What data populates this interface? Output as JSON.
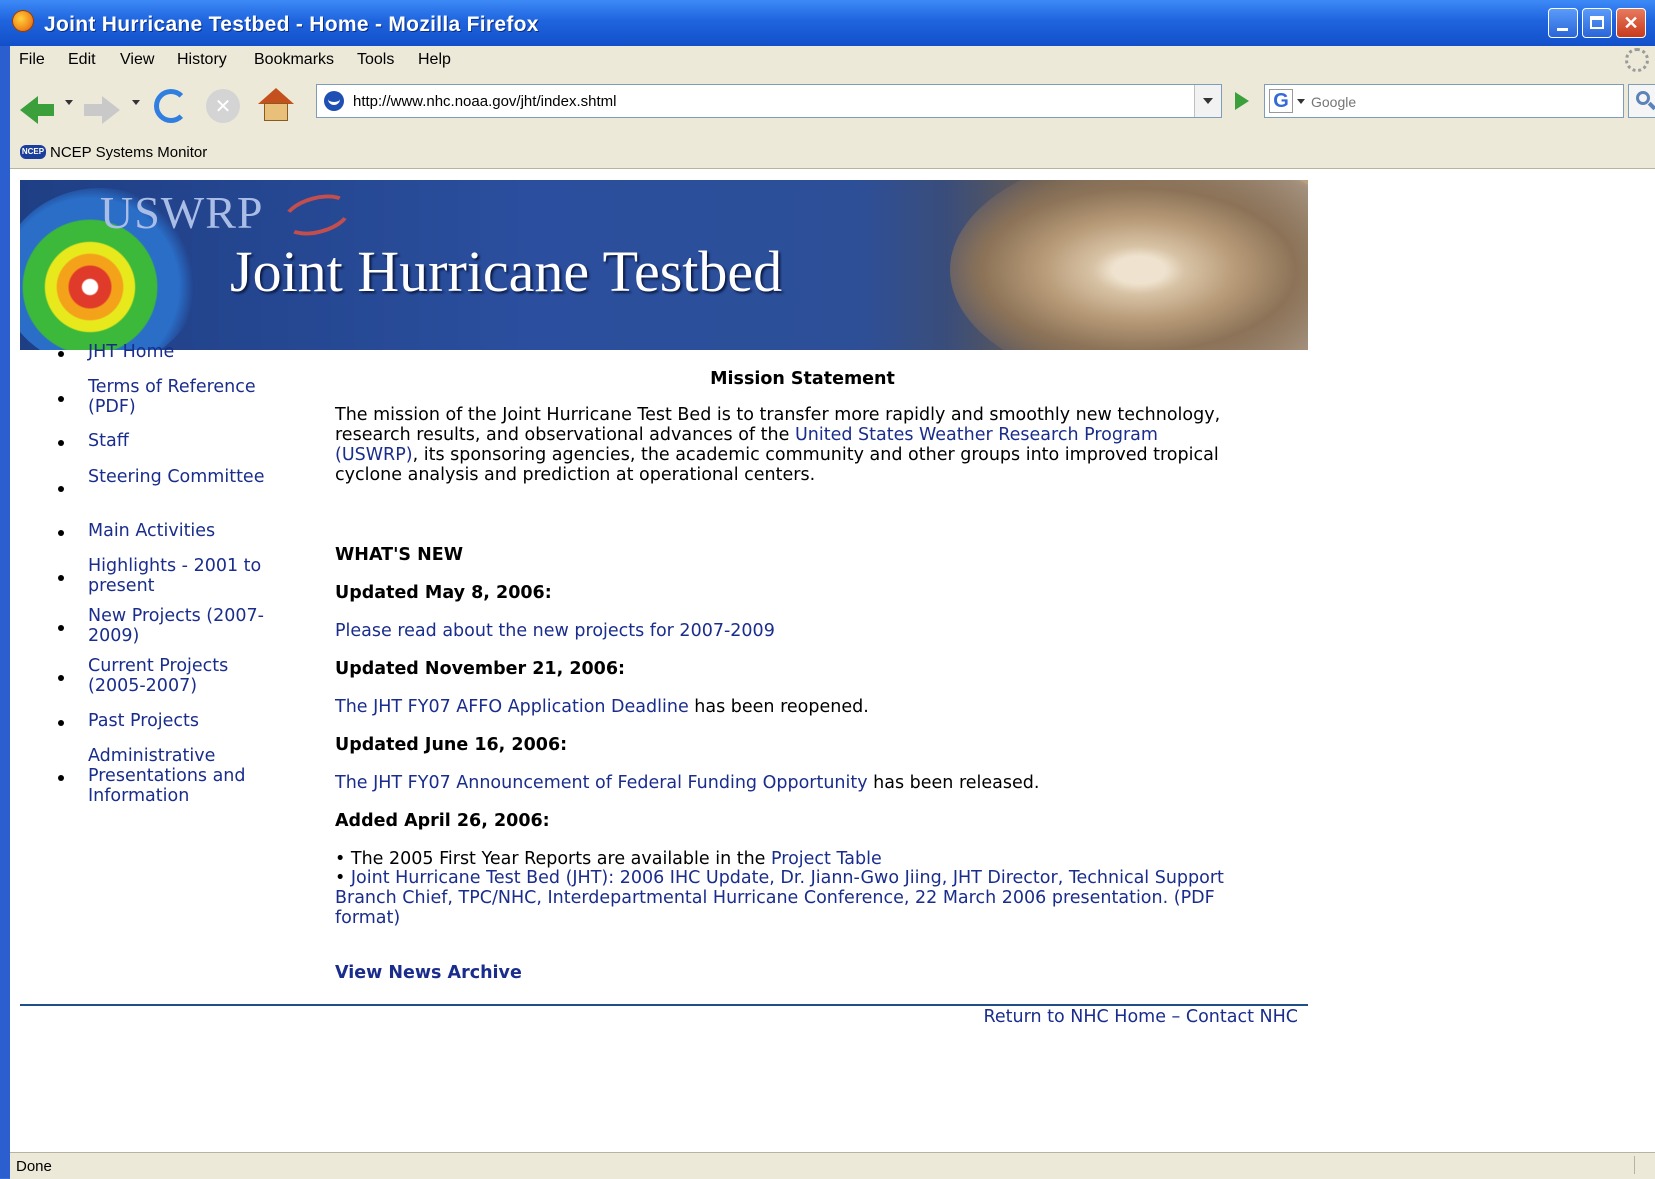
{
  "window": {
    "title": "Joint Hurricane Testbed - Home - Mozilla Firefox"
  },
  "menu": {
    "items": [
      "File",
      "Edit",
      "View",
      "History",
      "Bookmarks",
      "Tools",
      "Help"
    ]
  },
  "nav": {
    "url": "http://www.nhc.noaa.gov/jht/index.shtml",
    "search_placeholder": "Google"
  },
  "bookmarks": {
    "items": [
      "NCEP Systems Monitor"
    ],
    "icon_text": "NCEP"
  },
  "banner": {
    "logo": "USWRP",
    "headline": "Joint Hurricane Testbed"
  },
  "sidebar": {
    "items": [
      "JHT Home",
      "Terms of Reference (PDF)",
      "Staff",
      "Steering Committee",
      "Main Activities",
      "Highlights - 2001 to present",
      "New Projects (2007-2009)",
      "Current Projects (2005-2007)",
      "Past Projects",
      "Administrative Presentations and Information"
    ]
  },
  "main": {
    "mission_title": "Mission Statement",
    "mission_pre": "The mission of the Joint Hurricane Test Bed is to transfer more rapidly and smoothly new technology, research results, and observational advances of the ",
    "mission_link": "United States Weather Research Program (USWRP)",
    "mission_post": ", its sponsoring agencies, the academic community and other groups into improved tropical cyclone analysis and prediction at operational centers.",
    "whats_new": "WHAT'S NEW",
    "updates": [
      {
        "date": "Updated May 8, 2006:",
        "link": "Please read about the new projects for 2007-2009",
        "text": ""
      },
      {
        "date": "Updated November 21, 2006:",
        "link": "The JHT FY07 AFFO Application Deadline",
        "text": " has been reopened."
      },
      {
        "date": "Updated June 16, 2006:",
        "link": "The JHT FY07 Announcement of Federal Funding Opportunity",
        "text": " has been released."
      }
    ],
    "added": {
      "date": "Added April 26, 2006:",
      "item1_text": "• The 2005 First Year Reports are available in the ",
      "item1_link": "Project Table",
      "item2_bullet": "• ",
      "item2_link": "Joint Hurricane Test Bed (JHT): 2006 IHC Update, Dr. Jiann-Gwo Jiing, JHT Director, Technical Support Branch Chief, TPC/NHC, Interdepartmental Hurricane Conference, 22 March 2006 presentation.  (PDF format)"
    },
    "archive_link": "View News Archive"
  },
  "footer": {
    "home_link": "Return to NHC Home",
    "separator": " – ",
    "contact_link": "Contact NHC"
  },
  "status": {
    "text": "Done"
  }
}
